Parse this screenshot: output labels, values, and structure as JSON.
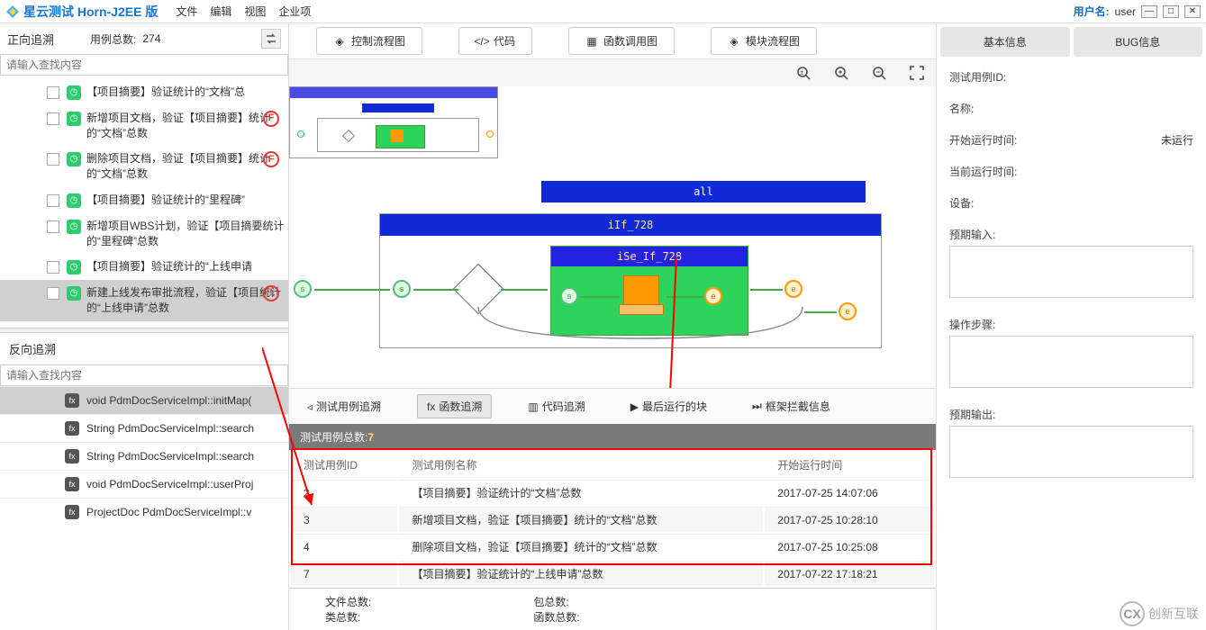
{
  "titleBar": {
    "appTitle": "星云测试 Horn-J2EE 版",
    "menus": [
      "文件",
      "编辑",
      "视图",
      "企业项"
    ],
    "userLabel": "用户名:",
    "userName": "user"
  },
  "leftPanel": {
    "forwardTrace": "正向追溯",
    "caseCountLabel": "用例总数:",
    "caseCount": "274",
    "searchPlaceholder": "请输入查找内容",
    "items": [
      {
        "text": "【项目摘要】验证统计的“文档”总",
        "marker": null
      },
      {
        "text": "新增项目文档，验证【项目摘要】统计的“文档”总数",
        "marker": "F"
      },
      {
        "text": "删除项目文档，验证【项目摘要】统计的“文档”总数",
        "marker": "F"
      },
      {
        "text": "【项目摘要】验证统计的“里程碑”",
        "marker": null
      },
      {
        "text": "新增项目WBS计划，验证【项目摘要统计的“里程碑”总数",
        "marker": null
      },
      {
        "text": "【项目摘要】验证统计的“上线申请",
        "marker": null
      },
      {
        "text": "新建上线发布审批流程，验证【项目统计的“上线申请”总数",
        "marker": "!",
        "selected": true
      }
    ],
    "reverseTrace": "反向追溯",
    "fnItems": [
      {
        "text": "void PdmDocServiceImpl::initMap(",
        "selected": true
      },
      {
        "text": "String PdmDocServiceImpl::search"
      },
      {
        "text": "String PdmDocServiceImpl::search"
      },
      {
        "text": "void PdmDocServiceImpl::userProj"
      },
      {
        "text": "ProjectDoc PdmDocServiceImpl::v"
      }
    ]
  },
  "centerPanel": {
    "tabs": [
      "控制流程图",
      "代码",
      "函数调用图",
      "模块流程图"
    ],
    "flow": {
      "allLabel": "all",
      "ifLabel": "iIf_728",
      "seLabel": "iSe_If_728"
    },
    "subTabs": [
      "测试用例追溯",
      "函数追溯",
      "代码追溯",
      "最后运行的块",
      "框架拦截信息"
    ],
    "subTabActive": 1,
    "countStripLabel": "测试用例总数:",
    "countStripNum": "7",
    "tableHeaders": [
      "测试用例ID",
      "测试用例名称",
      "开始运行时间"
    ],
    "tableRows": [
      {
        "id": "2",
        "name": "【项目摘要】验证统计的“文档”总数",
        "time": "2017-07-25 14:07:06"
      },
      {
        "id": "3",
        "name": "新增项目文档，验证【项目摘要】统计的“文档”总数",
        "time": "2017-07-25 10:28:10"
      },
      {
        "id": "4",
        "name": "删除项目文档，验证【项目摘要】统计的“文档”总数",
        "time": "2017-07-25 10:25:08"
      },
      {
        "id": "7",
        "name": "【项目摘要】验证统计的“上线申请”总数",
        "time": "2017-07-22 17:18:21"
      }
    ],
    "footerStats": {
      "fileCount": "文件总数:",
      "classCount": "类总数:",
      "pkgCount": "包总数:",
      "fnCount": "函数总数:"
    }
  },
  "rightPanel": {
    "tabs": [
      "基本信息",
      "BUG信息"
    ],
    "fields": {
      "caseId": "测试用例ID:",
      "name": "名称:",
      "startTime": "开始运行时间:",
      "startTimeVal": "未运行",
      "currentTime": "当前运行时间:",
      "device": "设备:",
      "expectedInput": "预期输入:",
      "steps": "操作步骤:",
      "expectedOutput": "预期输出:"
    }
  },
  "watermark": "创新互联"
}
